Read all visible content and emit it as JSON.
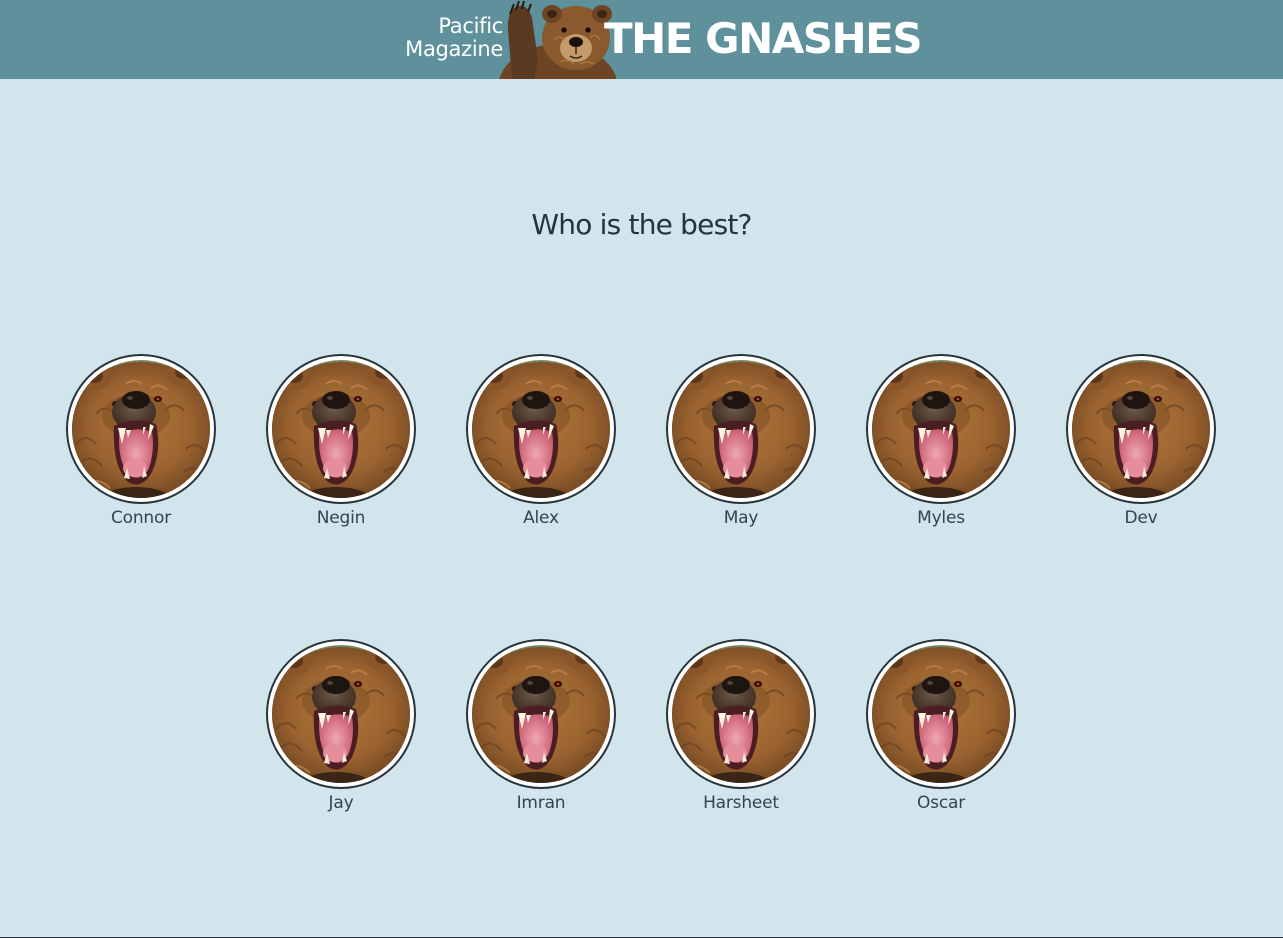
{
  "header": {
    "brand_line1": "Pacific",
    "brand_line2": "Magazine",
    "title": "THE GNASHES",
    "mascot_icon": "waving-bear-icon",
    "background": "#5f919c"
  },
  "page": {
    "background": "#d3e5ec",
    "question": "Who is the best?"
  },
  "people": [
    {
      "name": "Connor",
      "avatar_icon": "roaring-bear-icon"
    },
    {
      "name": "Negin",
      "avatar_icon": "roaring-bear-icon"
    },
    {
      "name": "Alex",
      "avatar_icon": "roaring-bear-icon"
    },
    {
      "name": "May",
      "avatar_icon": "roaring-bear-icon"
    },
    {
      "name": "Myles",
      "avatar_icon": "roaring-bear-icon"
    },
    {
      "name": "Dev",
      "avatar_icon": "roaring-bear-icon"
    },
    {
      "name": "Jay",
      "avatar_icon": "roaring-bear-icon"
    },
    {
      "name": "Imran",
      "avatar_icon": "roaring-bear-icon"
    },
    {
      "name": "Harsheet",
      "avatar_icon": "roaring-bear-icon"
    },
    {
      "name": "Oscar",
      "avatar_icon": "roaring-bear-icon"
    }
  ]
}
